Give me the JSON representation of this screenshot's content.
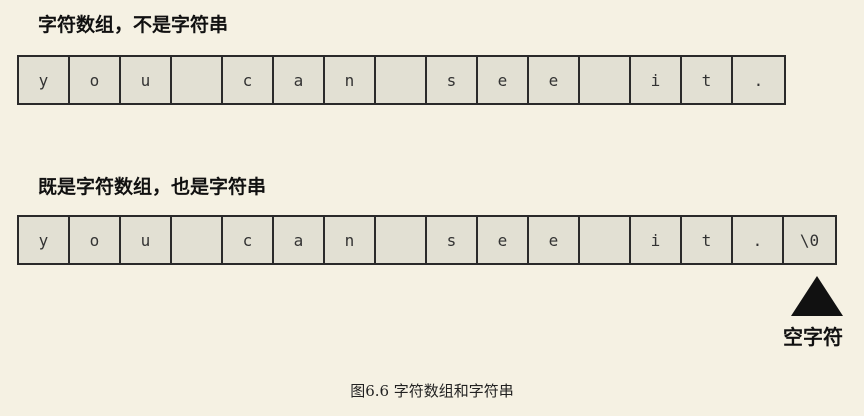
{
  "heading_1": "字符数组，不是字符串",
  "heading_2": "既是字符数组，也是字符串",
  "row_1_cells": [
    "y",
    "o",
    "u",
    "",
    "c",
    "a",
    "n",
    "",
    "s",
    "e",
    "e",
    "",
    "i",
    "t",
    "."
  ],
  "row_2_cells": [
    "y",
    "o",
    "u",
    "",
    "c",
    "a",
    "n",
    "",
    "s",
    "e",
    "e",
    "",
    "i",
    "t",
    ".",
    "\\0"
  ],
  "null_char_label": "空字符",
  "caption": "图6.6 字符数组和字符串"
}
